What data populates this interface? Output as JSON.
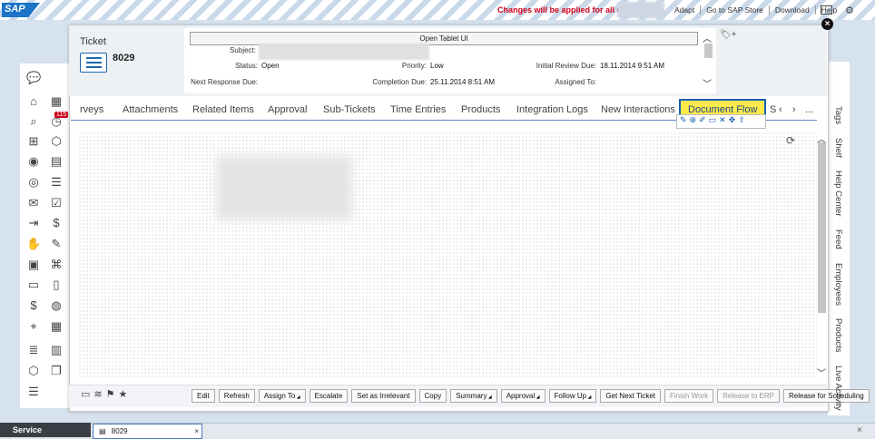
{
  "topbar": {
    "logo": "SAP",
    "notice": "Changes will be applied for all users",
    "links": [
      "Adapt",
      "Go to SAP Store",
      "Download",
      "Help"
    ],
    "icons": [
      "screen-icon",
      "gear-icon"
    ]
  },
  "ticket": {
    "label": "Ticket",
    "number": "8029",
    "open_tablet": "Open Tablet UI",
    "fields": {
      "subject_label": "Subject:",
      "status_label": "Status:",
      "status_value": "Open",
      "priority_label": "Priority:",
      "priority_value": "Low",
      "initial_review_label": "Initial Review Due:",
      "initial_review_value": "18.11.2014 9:51 AM",
      "next_response_label": "Next Response Due:",
      "completion_label": "Completion Due:",
      "completion_value": "25.11.2014 8:51 AM",
      "assigned_label": "Assigned To:"
    }
  },
  "tabs": {
    "items": [
      "rveys",
      "Attachments",
      "Related Items",
      "Approval",
      "Sub-Tickets",
      "Time Entries",
      "Products",
      "Integration Logs",
      "New Interactions"
    ],
    "active": "Document Flow",
    "overflow": "S",
    "more": "..."
  },
  "left_nav": {
    "badge": "115"
  },
  "footer": {
    "buttons": [
      {
        "label": "Edit",
        "disabled": false,
        "menu": false
      },
      {
        "label": "Refresh",
        "disabled": false,
        "menu": false
      },
      {
        "label": "Assign To",
        "disabled": false,
        "menu": true
      },
      {
        "label": "Escalate",
        "disabled": false,
        "menu": false
      },
      {
        "label": "Set as Irrelevant",
        "disabled": false,
        "menu": false
      },
      {
        "label": "Copy",
        "disabled": false,
        "menu": false
      },
      {
        "label": "Summary",
        "disabled": false,
        "menu": true
      },
      {
        "label": "Approval",
        "disabled": false,
        "menu": true
      },
      {
        "label": "Follow Up",
        "disabled": false,
        "menu": true
      },
      {
        "label": "Get Next Ticket",
        "disabled": false,
        "menu": false
      },
      {
        "label": "Finish Work",
        "disabled": true,
        "menu": false
      },
      {
        "label": "Release to ERP",
        "disabled": true,
        "menu": false
      },
      {
        "label": "Release for Scheduling",
        "disabled": false,
        "menu": false
      }
    ]
  },
  "right_panel": {
    "labels": [
      "Tags",
      "Shelf",
      "Help Center",
      "Feed",
      "Employees",
      "Products",
      "Live Activity"
    ]
  },
  "taskbar": {
    "service": "Service",
    "tab_label": "8029"
  }
}
